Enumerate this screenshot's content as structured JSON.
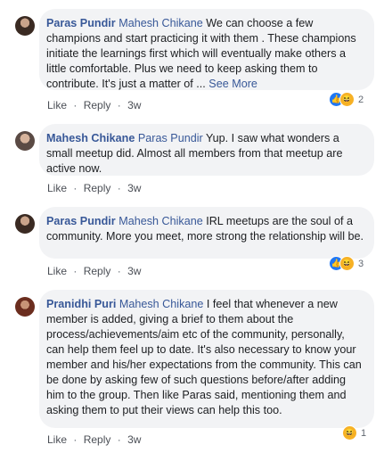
{
  "comments": [
    {
      "author": "Paras Pundir",
      "mention": "Mahesh Chikane",
      "text": " We can choose a few champions and start practicing it with them . These champions initiate the learnings first which will eventually make others a little comfortable. Plus we need to keep asking them to contribute. It's just a matter of ...",
      "see_more": "See More",
      "like": "Like",
      "reply": "Reply",
      "time": "3w",
      "reaction_count": "2"
    },
    {
      "author": "Mahesh Chikane",
      "mention": "Paras Pundir",
      "text": " Yup. I saw what wonders a small meetup did. Almost all members from that meetup are active now.",
      "like": "Like",
      "reply": "Reply",
      "time": "3w"
    },
    {
      "author": "Paras Pundir",
      "mention": "Mahesh Chikane",
      "text": " IRL meetups are the soul of a community. More you meet, more strong the relationship will be.",
      "like": "Like",
      "reply": "Reply",
      "time": "3w",
      "reaction_count": "3"
    },
    {
      "author": "Pranidhi Puri",
      "mention": "Mahesh Chikane",
      "text": " I feel that whenever a new member is added, giving a brief to them about the process/achievements/aim etc of the community, personally, can help them feel up to date. It's also necessary to know your member and his/her expectations from the community. This can be done by asking few of such questions before/after adding him to the group. Then like Paras said, mentioning them and asking them to put their views can help this too.",
      "like": "Like",
      "reply": "Reply",
      "time": "3w",
      "reaction_count": "1"
    }
  ],
  "separator": "·",
  "icons": {
    "like_reaction": "like-reaction-icon",
    "haha_reaction": "haha-reaction-icon"
  },
  "colors": {
    "name_link": "#385898",
    "bubble_bg": "#f2f3f5",
    "like_blue": "#2078f4",
    "haha_yellow": "#f7b125"
  }
}
